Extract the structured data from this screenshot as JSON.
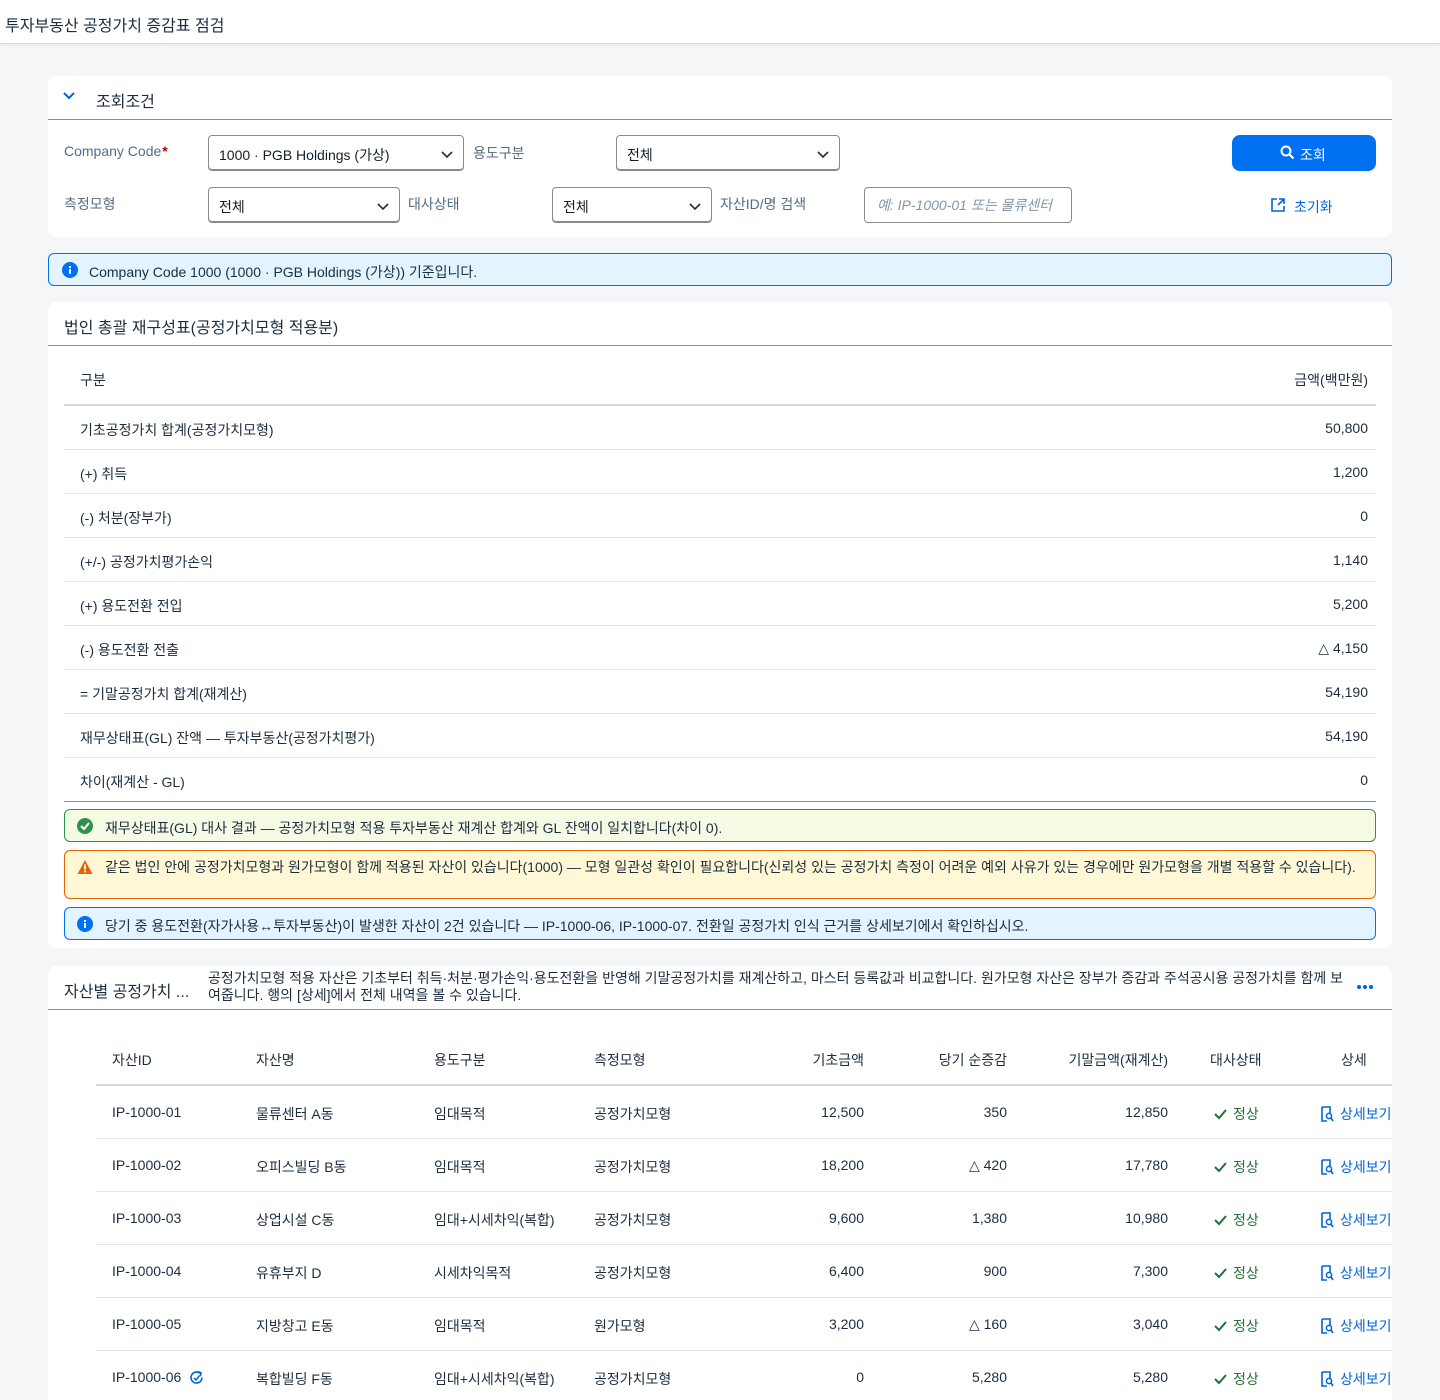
{
  "page": {
    "title": "투자부동산 공정가치 증감표 점검"
  },
  "filter": {
    "section_label": "조회조건",
    "company_code_label": "Company Code",
    "company_code_required": "*",
    "company_code_value": "1000 · PGB Holdings (가상)",
    "usage_label": "용도구분",
    "usage_value": "전체",
    "model_label": "측정모형",
    "model_value": "전체",
    "recon_label": "대사상태",
    "recon_value": "전체",
    "search_label": "자산ID/명 검색",
    "search_placeholder": "예: IP-1000-01 또는 물류센터",
    "search_button": "조회",
    "reset_button": "초기화"
  },
  "info_banner": "Company Code 1000 (1000 · PGB Holdings (가상)) 기준입니다.",
  "summary": {
    "title": "법인 총괄 재구성표(공정가치모형 적용분)",
    "col_label": "구분",
    "col_amount": "금액(백만원)",
    "rows": [
      {
        "label": "기초공정가치 합계(공정가치모형)",
        "amount": "50,800"
      },
      {
        "label": "(+) 취득",
        "amount": "1,200"
      },
      {
        "label": "(-) 처분(장부가)",
        "amount": "0"
      },
      {
        "label": "(+/-) 공정가치평가손익",
        "amount": "1,140"
      },
      {
        "label": "(+) 용도전환 전입",
        "amount": "5,200"
      },
      {
        "label": "(-) 용도전환 전출",
        "amount": "△ 4,150"
      },
      {
        "label": "= 기말공정가치 합계(재계산)",
        "amount": "54,190"
      },
      {
        "label": "재무상태표(GL) 잔액 — 투자부동산(공정가치평가)",
        "amount": "54,190"
      },
      {
        "label": "차이(재계산 - GL)",
        "amount": "0"
      }
    ],
    "ok_message": "재무상태표(GL) 대사 결과 — 공정가치모형 적용 투자부동산 재계산 합계와 GL 잔액이 일치합니다(차이 0).",
    "warn_message": "같은 법인 안에 공정가치모형과 원가모형이 함께 적용된 자산이 있습니다(1000) — 모형 일관성 확인이 필요합니다(신뢰성 있는 공정가치 측정이 어려운 예외 사유가 있는 경우에만 원가모형을 개별 적용할 수 있습니다).",
    "info_message": "당기 중 용도전환(자가사용↔투자부동산)이 발생한 자산이 2건 있습니다 — IP-1000-06, IP-1000-07. 전환일 공정가치 인식 근거를 상세보기에서 확인하십시오."
  },
  "assets": {
    "title": "자산별 공정가치 ...",
    "description": "공정가치모형 적용 자산은 기초부터 취득·처분·평가손익·용도전환을 반영해 기말공정가치를 재계산하고, 마스터 등록값과 비교합니다. 원가모형 자산은 장부가 증감과 주석공시용 공정가치를 함께 보여줍니다. 행의 [상세]에서 전체 내역을 볼 수 있습니다.",
    "columns": [
      "자산ID",
      "자산명",
      "용도구분",
      "측정모형",
      "기초금액",
      "당기 순증감",
      "기말금액(재계산)",
      "대사상태",
      "상세"
    ],
    "rows": [
      {
        "id": "IP-1000-01",
        "name": "물류센터 A동",
        "usage": "임대목적",
        "model": "공정가치모형",
        "begin": "12,500",
        "change": "350",
        "end": "12,850",
        "status": "정상",
        "detail": "상세보기"
      },
      {
        "id": "IP-1000-02",
        "name": "오피스빌딩 B동",
        "usage": "임대목적",
        "model": "공정가치모형",
        "begin": "18,200",
        "change": "△ 420",
        "end": "17,780",
        "status": "정상",
        "detail": "상세보기"
      },
      {
        "id": "IP-1000-03",
        "name": "상업시설 C동",
        "usage": "임대+시세차익(복합)",
        "model": "공정가치모형",
        "begin": "9,600",
        "change": "1,380",
        "end": "10,980",
        "status": "정상",
        "detail": "상세보기"
      },
      {
        "id": "IP-1000-04",
        "name": "유휴부지 D",
        "usage": "시세차익목적",
        "model": "공정가치모형",
        "begin": "6,400",
        "change": "900",
        "end": "7,300",
        "status": "정상",
        "detail": "상세보기"
      },
      {
        "id": "IP-1000-05",
        "name": "지방창고 E동",
        "usage": "임대목적",
        "model": "원가모형",
        "begin": "3,200",
        "change": "△ 160",
        "end": "3,040",
        "status": "정상",
        "detail": "상세보기"
      },
      {
        "id": "IP-1000-06",
        "name": "복합빌딩 F동",
        "usage": "임대+시세차익(복합)",
        "model": "공정가치모형",
        "begin": "0",
        "change": "5,280",
        "end": "5,280",
        "status": "정상",
        "detail": "상세보기",
        "transfer_icon": "transfer-icon"
      }
    ]
  },
  "colors": {
    "accent": "#0070f2",
    "positive": "#256f3a",
    "warning": "#e76500",
    "info_bg": "#e1f4ff"
  }
}
